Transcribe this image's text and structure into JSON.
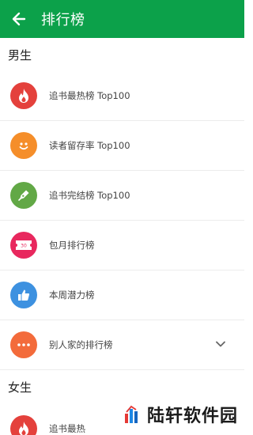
{
  "appbar": {
    "title": "排行榜",
    "back_icon": "arrow-left-icon",
    "color": "#0ca14a"
  },
  "sections": {
    "male": {
      "title": "男生",
      "items": [
        {
          "label": "追书最热榜 Top100",
          "icon": "flame-icon",
          "color": "#e4413c"
        },
        {
          "label": "读者留存率 Top100",
          "icon": "smiley-icon",
          "color": "#f58e2a"
        },
        {
          "label": "追书完结榜 Top100",
          "icon": "pen-icon",
          "color": "#62a846"
        },
        {
          "label": "包月排行榜",
          "icon": "ticket-icon",
          "color": "#e8285e"
        },
        {
          "label": "本周潜力榜",
          "icon": "thumbs-up-icon",
          "color": "#3d91e0"
        },
        {
          "label": "别人家的排行榜",
          "icon": "more-icon",
          "color": "#f36b3b"
        }
      ]
    },
    "female": {
      "title": "女生",
      "items": [
        {
          "label": "追书最热",
          "icon": "flame-icon",
          "color": "#e4413c"
        }
      ]
    }
  },
  "watermark": {
    "text": "陆轩软件园"
  }
}
